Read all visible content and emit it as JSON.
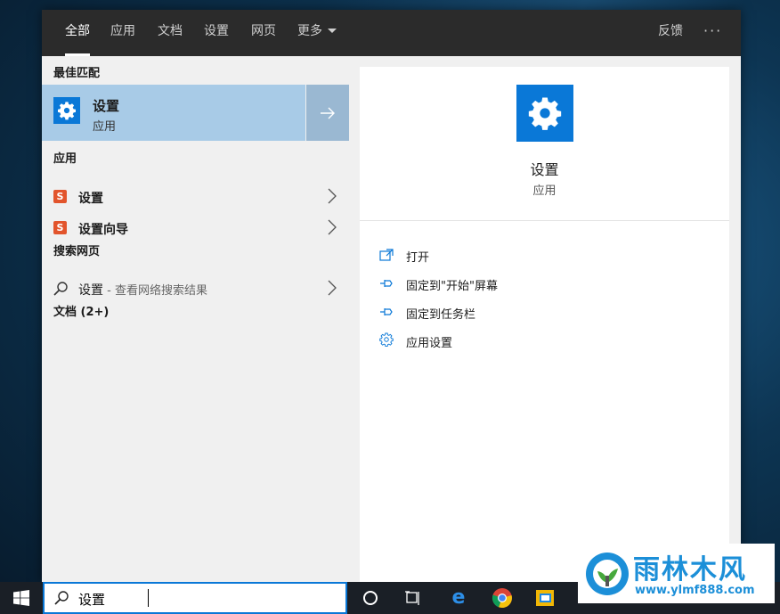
{
  "filter_tabs": [
    "全部",
    "应用",
    "文档",
    "设置",
    "网页",
    "更多"
  ],
  "feedback_label": "反馈",
  "more_options": "···",
  "sections": {
    "best_match": "最佳匹配",
    "apps": "应用",
    "web": "搜索网页",
    "documents": "文档 (2+)"
  },
  "best_match": {
    "title": "设置",
    "subtitle": "应用"
  },
  "apps": [
    {
      "label": "设置",
      "icon": "app-s-icon"
    },
    {
      "label": "设置向导",
      "icon": "app-s-icon"
    }
  ],
  "web_result": {
    "label": "设置",
    "hint": " - 查看网络搜索结果"
  },
  "preview": {
    "title": "设置",
    "subtitle": "应用",
    "actions": [
      {
        "label": "打开",
        "icon": "open-icon"
      },
      {
        "label": "固定到\"开始\"屏幕",
        "icon": "pin-icon"
      },
      {
        "label": "固定到任务栏",
        "icon": "pin-icon"
      },
      {
        "label": "应用设置",
        "icon": "gear-icon"
      }
    ]
  },
  "search": {
    "value": "设置"
  },
  "taskbar_icons": [
    "start-icon",
    "cortana-icon",
    "task-view-icon",
    "edge-icon",
    "chrome-icon",
    "explorer-icon"
  ],
  "watermark": {
    "title": "雨林木风",
    "url": "www.ylmf888.com"
  },
  "colors": {
    "accent": "#0a78d7",
    "selection": "#a8cbe7",
    "topbar": "#2b2b2b",
    "watermark": "#1c8fd8"
  }
}
